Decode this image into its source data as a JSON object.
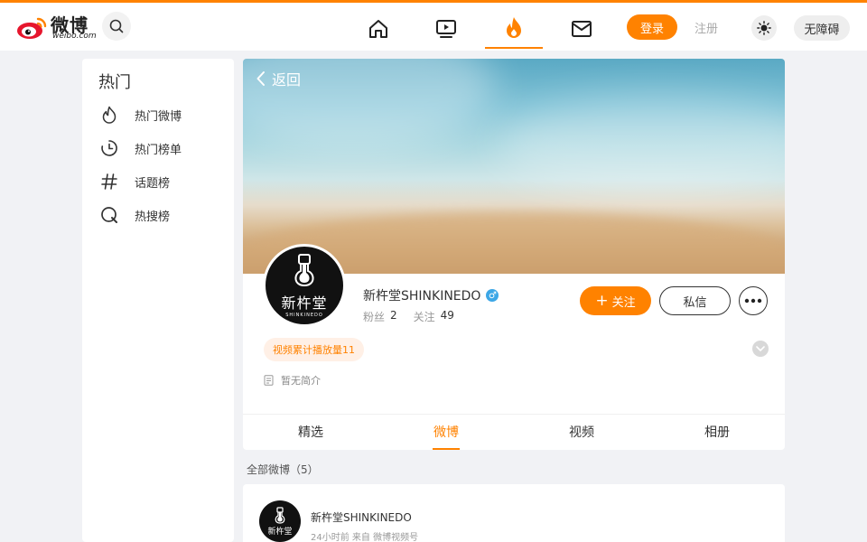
{
  "header": {
    "logo_cn": "微博",
    "logo_en": "weibo.com",
    "login_label": "登录",
    "register_label": "注册",
    "accessibility_label": "无障碍",
    "nav": [
      "home-icon",
      "video-icon",
      "hot-icon",
      "mail-icon"
    ],
    "active_nav": "hot-icon",
    "accent_color": "#ff8200"
  },
  "sidebar": {
    "title": "热门",
    "items": [
      {
        "label": "热门微博",
        "icon": "flame-icon"
      },
      {
        "label": "热门榜单",
        "icon": "clock-icon"
      },
      {
        "label": "话题榜",
        "icon": "hashtag-icon"
      },
      {
        "label": "热搜榜",
        "icon": "search-circle-icon"
      }
    ]
  },
  "profile": {
    "back_label": "返回",
    "avatar_text": "新杵堂",
    "avatar_text_en": "SHINKINEDO",
    "name": "新杵堂SHINKINEDO",
    "gender_icon": "male-icon",
    "fans_label": "粉丝",
    "fans_value": "2",
    "follow_label": "关注",
    "follow_value": "49",
    "follow_button": "关注",
    "message_button": "私信",
    "play_tag": "视频累计播放量11",
    "bio": "暂无简介",
    "tabs": [
      "精选",
      "微博",
      "视频",
      "相册"
    ],
    "active_tab": "微博"
  },
  "feed": {
    "all_label": "全部微博（5）",
    "first_post": {
      "author": "新杵堂SHINKINEDO",
      "meta": "24小时前  来自 微博视频号"
    }
  }
}
